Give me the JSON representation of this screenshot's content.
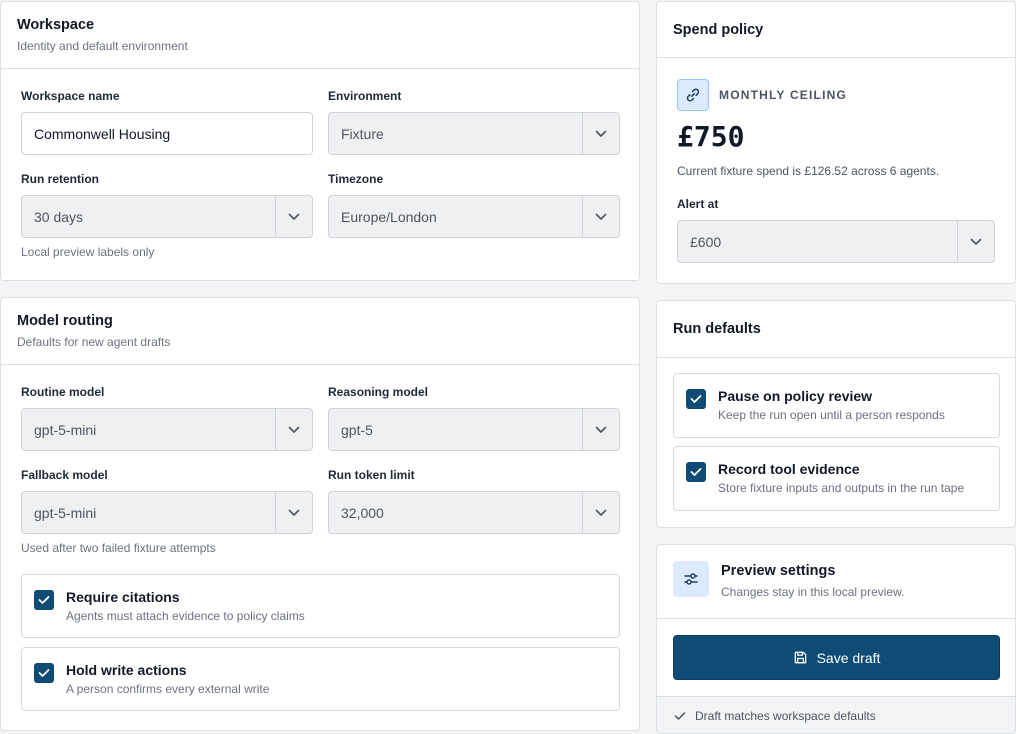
{
  "workspace": {
    "title": "Workspace",
    "subtitle": "Identity and default environment",
    "name_label": "Workspace name",
    "name_value": "Commonwell Housing",
    "environment_label": "Environment",
    "environment_value": "Fixture",
    "retention_label": "Run retention",
    "retention_value": "30 days",
    "timezone_label": "Timezone",
    "timezone_value": "Europe/London",
    "hint": "Local preview labels only"
  },
  "routing": {
    "title": "Model routing",
    "subtitle": "Defaults for new agent drafts",
    "routine_label": "Routine model",
    "routine_value": "gpt-5-mini",
    "reasoning_label": "Reasoning model",
    "reasoning_value": "gpt-5",
    "fallback_label": "Fallback model",
    "fallback_value": "gpt-5-mini",
    "token_label": "Run token limit",
    "token_value": "32,000",
    "hint": "Used after two failed fixture attempts",
    "checks": [
      {
        "title": "Require citations",
        "desc": "Agents must attach evidence to policy claims",
        "checked": true
      },
      {
        "title": "Hold write actions",
        "desc": "A person confirms every external write",
        "checked": true
      }
    ]
  },
  "spend": {
    "title": "Spend policy",
    "eyebrow": "MONTHLY CEILING",
    "amount": "£750",
    "note": "Current fixture spend is £126.52 across 6 agents.",
    "alert_label": "Alert at",
    "alert_value": "£600"
  },
  "run_defaults": {
    "title": "Run defaults",
    "checks": [
      {
        "title": "Pause on policy review",
        "desc": "Keep the run open until a person responds",
        "checked": true
      },
      {
        "title": "Record tool evidence",
        "desc": "Store fixture inputs and outputs in the run tape",
        "checked": true
      }
    ]
  },
  "preview": {
    "title": "Preview settings",
    "subtitle": "Changes stay in this local preview.",
    "save_label": "Save draft",
    "status": "Draft matches workspace defaults"
  },
  "colors": {
    "accent": "#0f4c75",
    "icon_bg": "#dbeafe",
    "footer_bg": "#f3f4f6"
  },
  "icons": [
    "chevron-down-icon",
    "link-icon",
    "check-icon",
    "sliders-icon",
    "save-icon"
  ]
}
